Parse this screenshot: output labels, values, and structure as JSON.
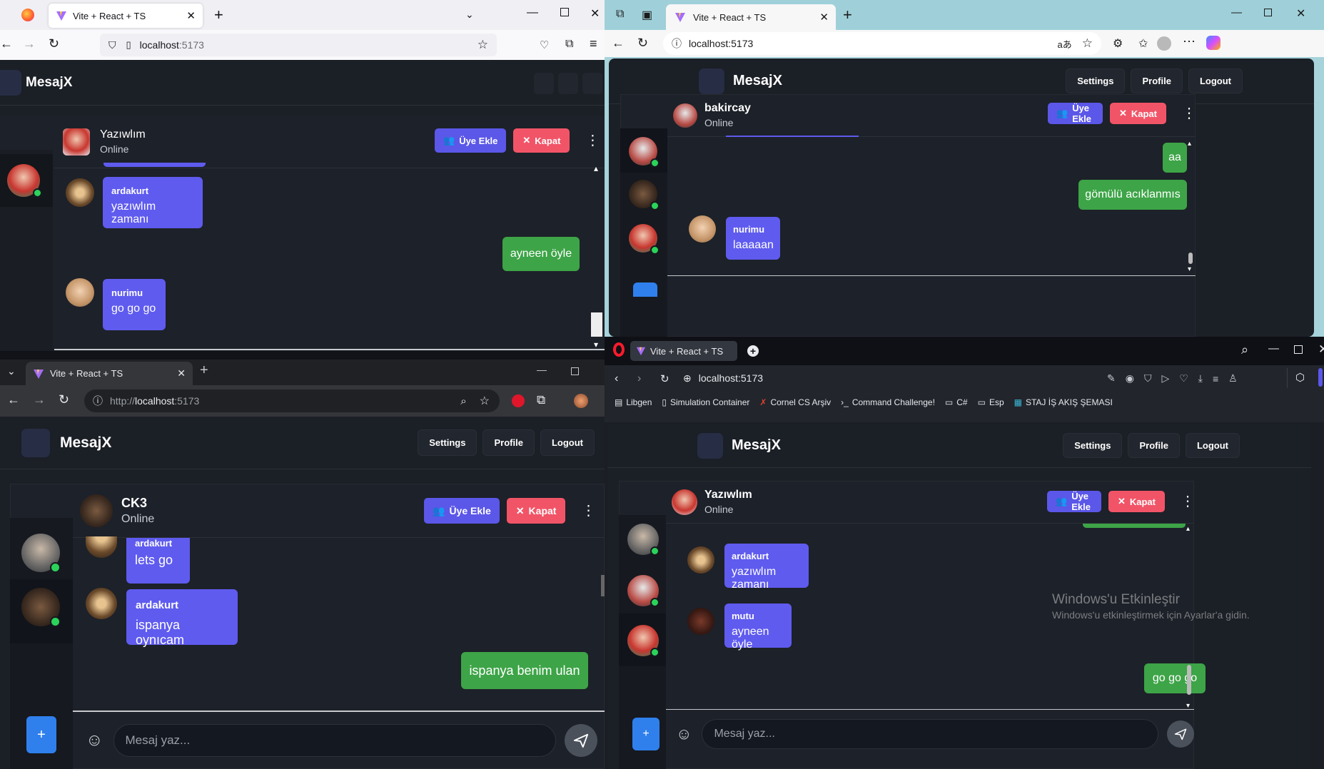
{
  "tab_title": "Vite + React + TS",
  "app_name": "MesajX",
  "nav": {
    "settings": "Settings",
    "profile": "Profile",
    "logout": "Logout"
  },
  "actions": {
    "add_member": "Üye Ekle",
    "close": "Kapat",
    "menu": "⋮"
  },
  "composer": {
    "placeholder": "Mesaj yaz...",
    "plus": "+"
  },
  "firefox": {
    "url_host": "localhost",
    "url_port": ":5173",
    "contact": {
      "name": "Yazıwlım",
      "status": "Online"
    },
    "messages": [
      {
        "author": "ardakurt",
        "text": "yazıwlım zamanı",
        "dir": "in"
      },
      {
        "text": "ayneen öyle",
        "dir": "out"
      },
      {
        "author": "nurimu",
        "text": "go go go",
        "dir": "in"
      }
    ]
  },
  "edge": {
    "url": "localhost:5173",
    "contact": {
      "name": "bakircay",
      "status": "Online"
    },
    "messages": [
      {
        "text": "aa",
        "dir": "out"
      },
      {
        "text": "gömülü acıklanmıs",
        "dir": "out"
      },
      {
        "author": "nurimu",
        "text": "laaaaan",
        "dir": "in"
      }
    ]
  },
  "chrome": {
    "url_prefix": "http://",
    "url_host": "localhost",
    "url_port": ":5173",
    "contact": {
      "name": "CK3",
      "status": "Online"
    },
    "messages": [
      {
        "author": "ardakurt",
        "text": "lets go",
        "dir": "in"
      },
      {
        "author": "ardakurt",
        "text": "ispanya oynıcam",
        "dir": "in"
      },
      {
        "text": "ispanya benim ulan",
        "dir": "out"
      }
    ]
  },
  "opera": {
    "url": "localhost:5173",
    "bookmarks": [
      "Libgen",
      "Simulation Container",
      "Cornel CS Arşiv",
      "Command Challenge!",
      "C#",
      "Esp",
      "STAJ İŞ AKIŞ ŞEMASI"
    ],
    "contact": {
      "name": "Yazıwlım",
      "status": "Online"
    },
    "messages": [
      {
        "author": "ardakurt",
        "text": "yazıwlım zamanı",
        "dir": "in"
      },
      {
        "author": "mutu",
        "text": "ayneen öyle",
        "dir": "in"
      },
      {
        "text": "go go go",
        "dir": "out"
      }
    ]
  },
  "watermark": {
    "line1": "Windows'u Etkinleştir",
    "line2": "Windows'u etkinleştirmek için Ayarlar'a gidin."
  },
  "colors": {
    "accent": "#5f5bef",
    "outgoing": "#3da447",
    "danger": "#f25467",
    "online": "#2bd35a",
    "plus": "#2f80ed"
  }
}
